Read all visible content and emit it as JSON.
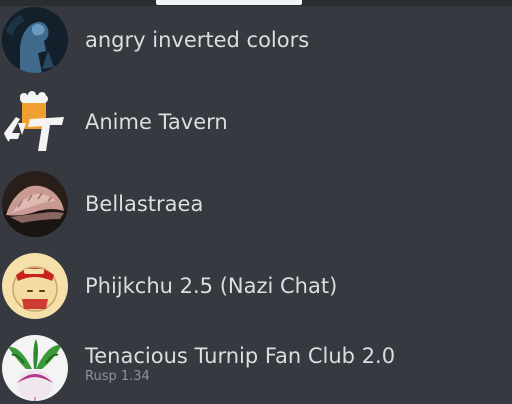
{
  "servers": [
    {
      "name": "angry inverted colors",
      "icon": "inverted-colors-avatar-icon"
    },
    {
      "name": "Anime Tavern",
      "icon": "anime-tavern-avatar-icon"
    },
    {
      "name": "Bellastraea",
      "icon": "bellastraea-avatar-icon"
    },
    {
      "name": "Phijkchu 2.5 (Nazi Chat)",
      "icon": "phijkchu-avatar-icon"
    },
    {
      "name": "Tenacious Turnip Fan Club 2.0",
      "subtitle": "Rusp 1.34",
      "icon": "turnip-avatar-icon"
    }
  ],
  "colors": {
    "background": "#36393f",
    "text": "#dcddde",
    "subtext": "#8e9297",
    "tab_indicator": "#f2f3f5"
  }
}
